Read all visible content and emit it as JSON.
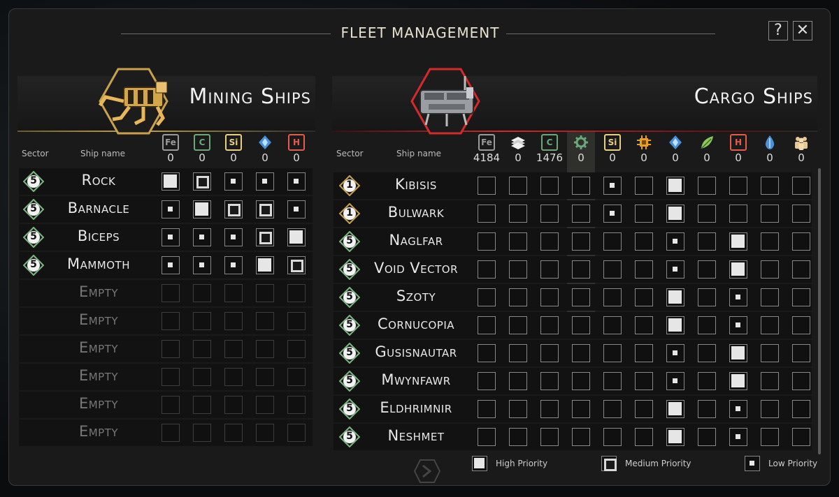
{
  "window": {
    "title": "FLEET MANAGEMENT",
    "help_label": "?",
    "close_label": "✕"
  },
  "column_headers": {
    "sector": "Sector",
    "ship_name": "Ship name"
  },
  "colors": {
    "mining_accent": "#c9a24a",
    "cargo_accent": "#d42a2a",
    "iron": "#9a9a9a",
    "carbon": "#6aa878",
    "silicon": "#e8d080",
    "crystal": "#6ab0e8",
    "hydrogen": "#e85a4a"
  },
  "mining": {
    "title": "Mining Ships",
    "resources": [
      {
        "icon": "iron-icon",
        "label": "Fe",
        "count": "0"
      },
      {
        "icon": "carbon-icon",
        "label": "C",
        "count": "0"
      },
      {
        "icon": "silicon-icon",
        "label": "Si",
        "count": "0"
      },
      {
        "icon": "crystal-icon",
        "label": "",
        "count": "0"
      },
      {
        "icon": "hydrogen-icon",
        "label": "H",
        "count": "0"
      }
    ],
    "ships": [
      {
        "sector": "5",
        "name": "Rock",
        "priorities": [
          "high",
          "med",
          "low",
          "low",
          "low"
        ]
      },
      {
        "sector": "5",
        "name": "Barnacle",
        "priorities": [
          "low",
          "high",
          "med",
          "med",
          "low"
        ]
      },
      {
        "sector": "5",
        "name": "Biceps",
        "priorities": [
          "low",
          "low",
          "low",
          "med",
          "high"
        ]
      },
      {
        "sector": "5",
        "name": "Mammoth",
        "priorities": [
          "low",
          "low",
          "low",
          "high",
          "med"
        ]
      },
      {
        "sector": "",
        "name": "Empty",
        "priorities": [
          "none",
          "none",
          "none",
          "none",
          "none"
        ]
      },
      {
        "sector": "",
        "name": "Empty",
        "priorities": [
          "none",
          "none",
          "none",
          "none",
          "none"
        ]
      },
      {
        "sector": "",
        "name": "Empty",
        "priorities": [
          "none",
          "none",
          "none",
          "none",
          "none"
        ]
      },
      {
        "sector": "",
        "name": "Empty",
        "priorities": [
          "none",
          "none",
          "none",
          "none",
          "none"
        ]
      },
      {
        "sector": "",
        "name": "Empty",
        "priorities": [
          "none",
          "none",
          "none",
          "none",
          "none"
        ]
      },
      {
        "sector": "",
        "name": "Empty",
        "priorities": [
          "none",
          "none",
          "none",
          "none",
          "none"
        ]
      }
    ]
  },
  "cargo": {
    "title": "Cargo Ships",
    "resources": [
      {
        "icon": "iron-icon",
        "label": "Fe",
        "count": "4184"
      },
      {
        "icon": "metal-plates-icon",
        "label": "",
        "count": "0"
      },
      {
        "icon": "carbon-icon",
        "label": "C",
        "count": "1476"
      },
      {
        "icon": "gear-icon",
        "label": "",
        "count": "0",
        "selected": true
      },
      {
        "icon": "silicon-icon",
        "label": "Si",
        "count": "0"
      },
      {
        "icon": "chip-icon",
        "label": "",
        "count": "0"
      },
      {
        "icon": "crystal-icon",
        "label": "",
        "count": "0"
      },
      {
        "icon": "leaf-icon",
        "label": "",
        "count": "0"
      },
      {
        "icon": "hydrogen-icon",
        "label": "H",
        "count": "0"
      },
      {
        "icon": "droplet-icon",
        "label": "",
        "count": "0"
      },
      {
        "icon": "crew-icon",
        "label": "",
        "count": "0"
      }
    ],
    "ships": [
      {
        "sector": "1",
        "name": "Kibisis",
        "priorities": [
          "none",
          "none",
          "none",
          "none",
          "low",
          "none",
          "high",
          "none",
          "none",
          "none",
          "none"
        ]
      },
      {
        "sector": "1",
        "name": "Bulwark",
        "priorities": [
          "none",
          "none",
          "none",
          "none",
          "low",
          "none",
          "high",
          "none",
          "none",
          "none",
          "none"
        ]
      },
      {
        "sector": "5",
        "name": "Naglfar",
        "priorities": [
          "none",
          "none",
          "none",
          "none",
          "none",
          "none",
          "low",
          "none",
          "high",
          "none",
          "none"
        ]
      },
      {
        "sector": "5",
        "name": "Void Vector",
        "priorities": [
          "none",
          "none",
          "none",
          "none",
          "none",
          "none",
          "low",
          "none",
          "high",
          "none",
          "none"
        ]
      },
      {
        "sector": "5",
        "name": "Szoty",
        "priorities": [
          "none",
          "none",
          "none",
          "none",
          "none",
          "none",
          "high",
          "none",
          "low",
          "none",
          "none"
        ]
      },
      {
        "sector": "5",
        "name": "Cornucopia",
        "priorities": [
          "none",
          "none",
          "none",
          "none",
          "none",
          "none",
          "high",
          "none",
          "low",
          "none",
          "none"
        ]
      },
      {
        "sector": "5",
        "name": "Gusisnautar",
        "priorities": [
          "none",
          "none",
          "none",
          "none",
          "none",
          "none",
          "low",
          "none",
          "high",
          "none",
          "none"
        ]
      },
      {
        "sector": "5",
        "name": "Mwynfawr",
        "priorities": [
          "none",
          "none",
          "none",
          "none",
          "none",
          "none",
          "low",
          "none",
          "high",
          "none",
          "none"
        ]
      },
      {
        "sector": "5",
        "name": "Eldhrimnir",
        "priorities": [
          "none",
          "none",
          "none",
          "none",
          "none",
          "none",
          "high",
          "none",
          "low",
          "none",
          "none"
        ]
      },
      {
        "sector": "5",
        "name": "Neshmet",
        "priorities": [
          "none",
          "none",
          "none",
          "none",
          "none",
          "none",
          "high",
          "none",
          "low",
          "none",
          "none"
        ]
      }
    ]
  },
  "legend": {
    "high": "High Priority",
    "medium": "Medium Priority",
    "low": "Low Priority"
  }
}
